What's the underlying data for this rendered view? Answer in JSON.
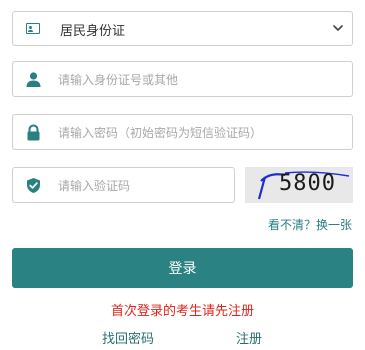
{
  "id_type_select": {
    "selected": "居民身份证",
    "icon": "id-card-icon"
  },
  "id_input": {
    "placeholder": "请输入身份证号或其他",
    "icon": "user-icon"
  },
  "password_input": {
    "placeholder": "请输入密码（初始密码为短信验证码）",
    "icon": "lock-icon"
  },
  "captcha_input": {
    "placeholder": "请输入验证码",
    "icon": "shield-check-icon"
  },
  "captcha_image": {
    "code": "5800"
  },
  "refresh_captcha": "看不清？换一张",
  "login_button": "登录",
  "notice": "首次登录的考生请先注册",
  "links": {
    "forgot_password": "找回密码",
    "register": "注册"
  },
  "colors": {
    "accent": "#2a8283",
    "notice": "#e1251b",
    "link": "#2a7f80"
  }
}
